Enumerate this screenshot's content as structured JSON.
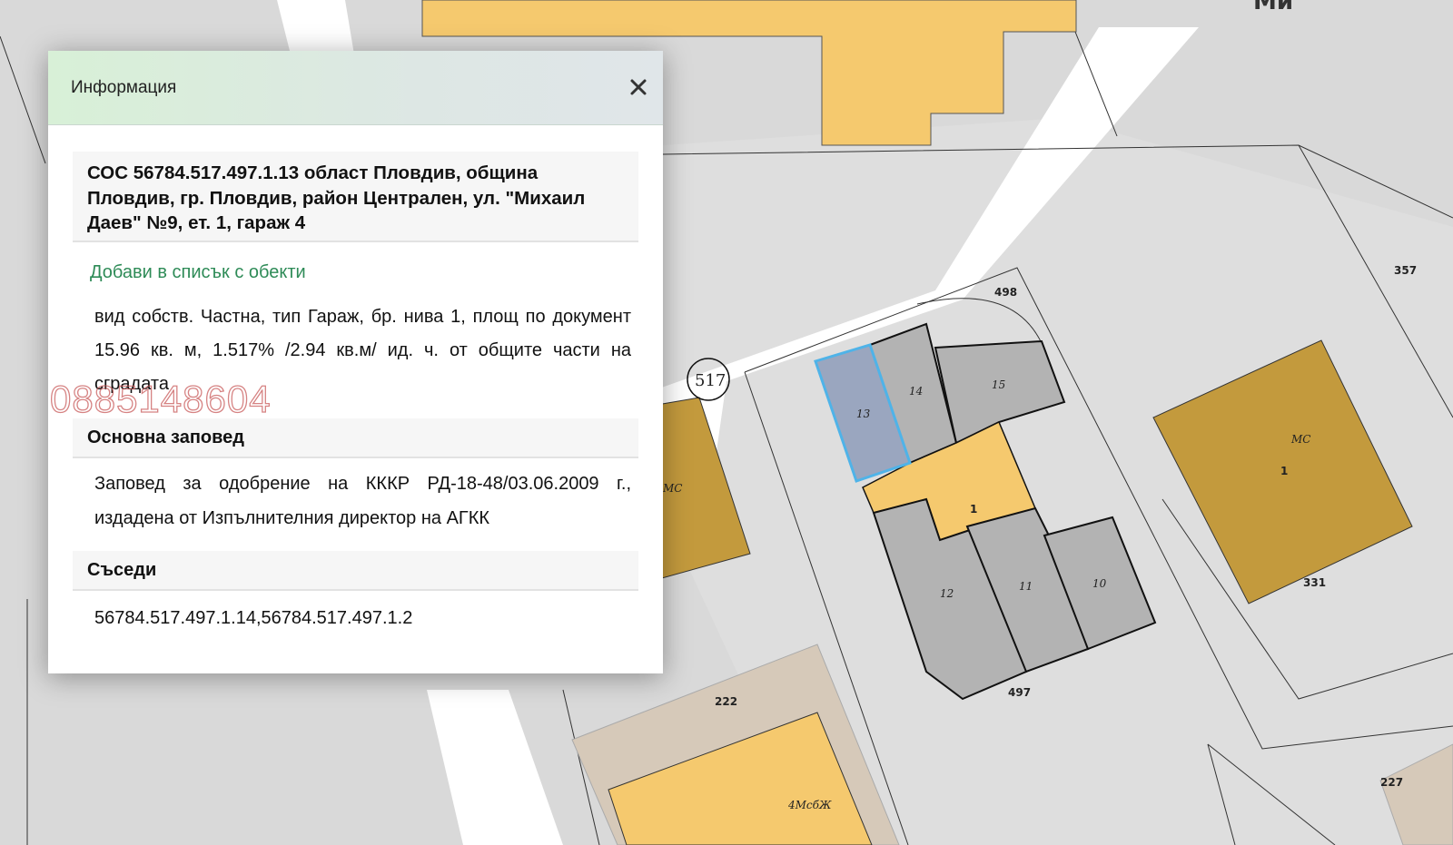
{
  "panel": {
    "title": "Информация",
    "close_icon": "close-icon",
    "object_title": "СОС 56784.517.497.1.13 област Пловдив, община Пловдив, гр. Пловдив, район Централен, ул. \"Михаил Даев\" №9, ет. 1, гараж 4",
    "add_link": "Добави в списък с обекти",
    "details": "вид собств. Частна, тип Гараж, бр. нива 1, площ по документ 15.96 кв. м, 1.517% /2.94 кв.м/ ид. ч. от общите части на сградата",
    "order_heading": "Основна заповед",
    "order_text": "Заповед за одобрение на КККР РД-18-48/03.06.2009 г., издадена от Изпълнителния директор на АГКК",
    "neighbors_heading": "Съседи",
    "neighbors_text": "56784.517.497.1.14,56784.517.497.1.2"
  },
  "watermark": "0885148604",
  "map": {
    "labels": {
      "p498": "498",
      "p357": "357",
      "p517": "517",
      "u13": "13",
      "u14": "14",
      "u15": "15",
      "b1": "1",
      "u12": "12",
      "u11": "11",
      "u10": "10",
      "p497": "497",
      "ms_right": "МС",
      "ms_right_num": "1",
      "p331": "331",
      "ms_left": "МС",
      "p222": "222",
      "b4ms": "4МсбЖ",
      "p227": "227",
      "street_top": "Ми"
    },
    "colors": {
      "selected_unit": "#9aa6bf",
      "selected_border": "#4fb3e8",
      "building_gray": "#b3b3b3",
      "building_yellow": "#f5c96e",
      "building_brown": "#c39a3d",
      "street": "#ffffff"
    }
  }
}
